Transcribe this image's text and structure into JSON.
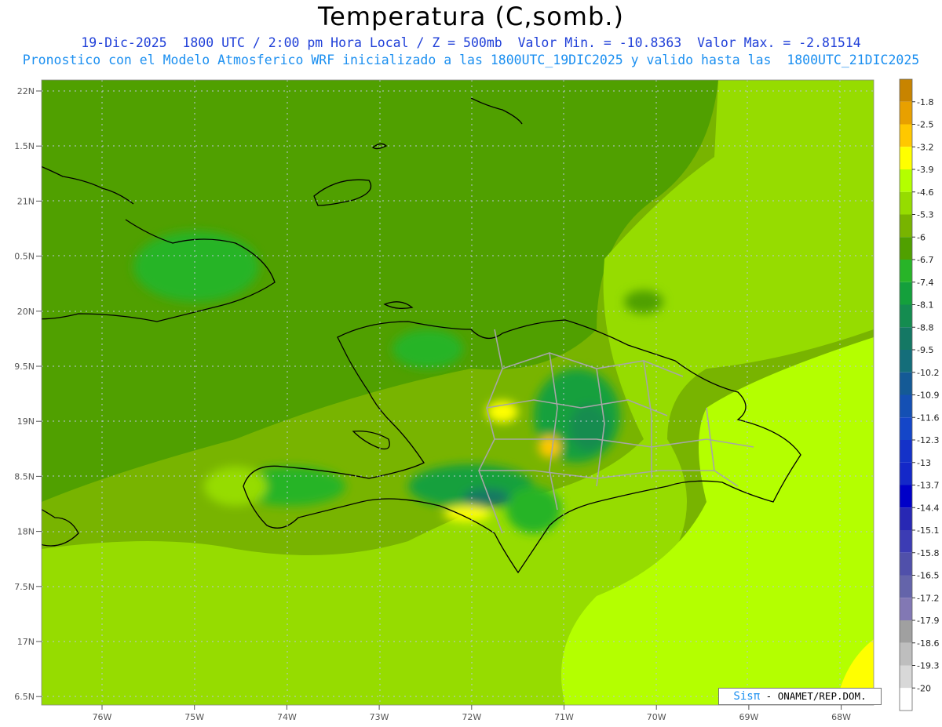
{
  "title": "Temperatura (C,somb.)",
  "subtitle_line1": "19-Dic-2025  1800 UTC / 2:00 pm Hora Local / Z = 500mb  Valor Min. = -10.8363  Valor Max. = -2.81514",
  "subtitle_line2": "Pronostico con el Modelo Atmosferico WRF inicializado a las 1800UTC_19DIC2025 y valido hasta las  1800UTC_21DIC2025",
  "credit": {
    "brand": "Sisπ",
    "org": "- ONAMET/REP.DOM."
  },
  "chart_data": {
    "type": "heatmap",
    "title": "Temperatura (C,somb.)",
    "variable": "Temperature at 500 mb (C, shaded)",
    "level": "500mb",
    "valid_time": "19-Dic-2025 1800 UTC / 2:00 pm Hora Local",
    "value_min": -10.8363,
    "value_max": -2.81514,
    "lon_range": [
      -76.6,
      -67.6
    ],
    "lat_range": [
      16.4,
      22.1
    ],
    "x_ticks": [
      "76W",
      "75W",
      "74W",
      "73W",
      "72W",
      "71W",
      "70W",
      "69W",
      "68W"
    ],
    "y_ticks": [
      "22N",
      "1.5N",
      "21N",
      "0.5N",
      "20N",
      "9.5N",
      "19N",
      "8.5N",
      "18N",
      "7.5N",
      "17N",
      "6.5N"
    ],
    "colorbar_labels": [
      "-1.8",
      "-2.5",
      "-3.2",
      "-3.9",
      "-4.6",
      "-5.3",
      "-6",
      "-6.7",
      "-7.4",
      "-8.1",
      "-8.8",
      "-9.5",
      "-10.2",
      "-10.9",
      "-11.6",
      "-12.3",
      "-13",
      "-13.7",
      "-14.4",
      "-15.1",
      "-15.8",
      "-16.5",
      "-17.2",
      "-17.9",
      "-18.6",
      "-19.3",
      "-20"
    ],
    "colorbar_colors": [
      "#c88400",
      "#e8a000",
      "#ffc800",
      "#ffff00",
      "#b4ff00",
      "#96dc00",
      "#78b400",
      "#50a000",
      "#28b428",
      "#14a03c",
      "#148c50",
      "#147864",
      "#146e7a",
      "#145a96",
      "#1450b4",
      "#1446c8",
      "#1432c8",
      "#1428c8",
      "#0000c8",
      "#2828b4",
      "#3c3cb4",
      "#5050aa",
      "#6464aa",
      "#8278b4",
      "#a0a0a0",
      "#bebebe",
      "#d8d8d8",
      "#ffffff"
    ],
    "grid": true
  }
}
